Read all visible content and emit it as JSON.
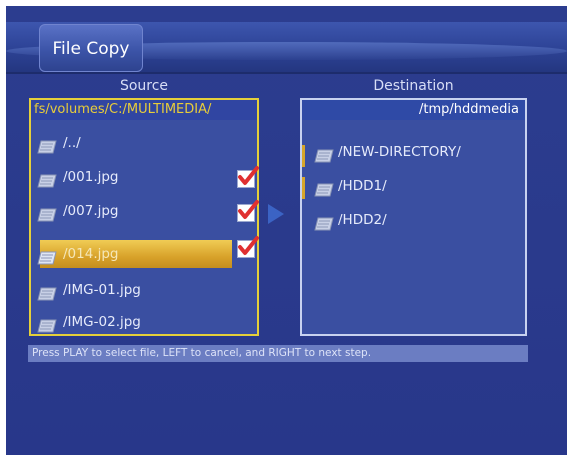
{
  "title": "File Copy",
  "source": {
    "header": "Source",
    "path": "fs/volumes/C:/MULTIMEDIA/",
    "items": [
      {
        "label": "/../",
        "checked": false
      },
      {
        "label": "/001.jpg",
        "checked": true
      },
      {
        "label": "/007.jpg",
        "checked": true
      },
      {
        "label": "/014.jpg",
        "checked": true
      },
      {
        "label": "/IMG-01.jpg",
        "checked": false
      },
      {
        "label": "/IMG-02.jpg",
        "checked": false
      }
    ],
    "selected_index": 3
  },
  "destination": {
    "header": "Destination",
    "path": "/tmp/hddmedia",
    "items": [
      {
        "label": "/NEW-DIRECTORY/"
      },
      {
        "label": "/HDD1/"
      },
      {
        "label": "/HDD2/"
      }
    ]
  },
  "status": "Press PLAY to select file, LEFT to cancel, and RIGHT to next step.",
  "colors": {
    "background": "#2a3a8c",
    "highlight": "#d8a22a",
    "path_text": "#e8cd3a",
    "check_mark": "#e03030"
  },
  "icons": {
    "item": "file-folder-icon",
    "check": "checkmark-icon",
    "transfer": "arrow-right-icon"
  }
}
